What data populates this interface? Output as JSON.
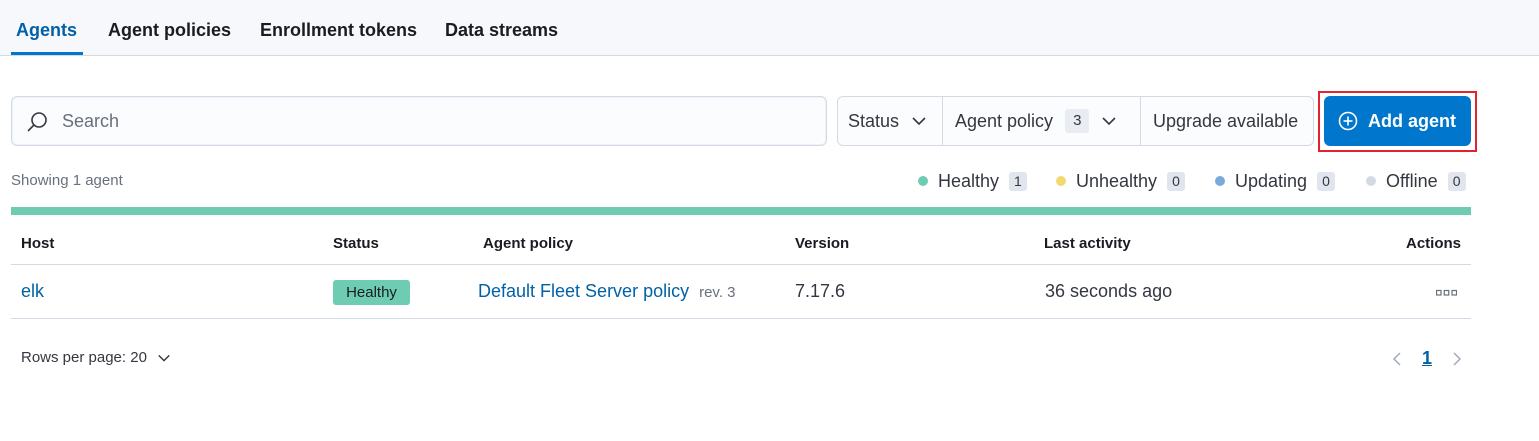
{
  "tabs": [
    {
      "label": "Agents",
      "active": true
    },
    {
      "label": "Agent policies",
      "active": false
    },
    {
      "label": "Enrollment tokens",
      "active": false
    },
    {
      "label": "Data streams",
      "active": false
    }
  ],
  "search": {
    "placeholder": "Search",
    "icon": "search-icon"
  },
  "filters": {
    "status_label": "Status",
    "agent_policy_label": "Agent policy",
    "agent_policy_count": "3",
    "upgrade_label": "Upgrade available"
  },
  "add_agent": {
    "label": "Add agent",
    "icon": "plus-in-circle-icon"
  },
  "summary": {
    "showing_text": "Showing 1 agent"
  },
  "status_legend": [
    {
      "label": "Healthy",
      "count": "1",
      "color": "#6dccb1"
    },
    {
      "label": "Unhealthy",
      "count": "0",
      "color": "#f1d86f"
    },
    {
      "label": "Updating",
      "count": "0",
      "color": "#79aad9"
    },
    {
      "label": "Offline",
      "count": "0",
      "color": "#d3dae6"
    }
  ],
  "health_fraction_healthy": 1.0,
  "table": {
    "columns": [
      "Host",
      "Status",
      "Agent policy",
      "Version",
      "Last activity",
      "Actions"
    ],
    "rows": [
      {
        "host": "elk",
        "status": "Healthy",
        "policy": "Default Fleet Server policy",
        "policy_rev": "rev. 3",
        "version": "7.17.6",
        "last_activity": "36 seconds ago"
      }
    ]
  },
  "pagination": {
    "rows_per_page_label": "Rows per page: 20",
    "current_page": "1"
  },
  "colors": {
    "primary": "#0077cc",
    "link": "#0061a6",
    "healthy": "#6dccb1",
    "highlight_outline": "#e0232e"
  }
}
